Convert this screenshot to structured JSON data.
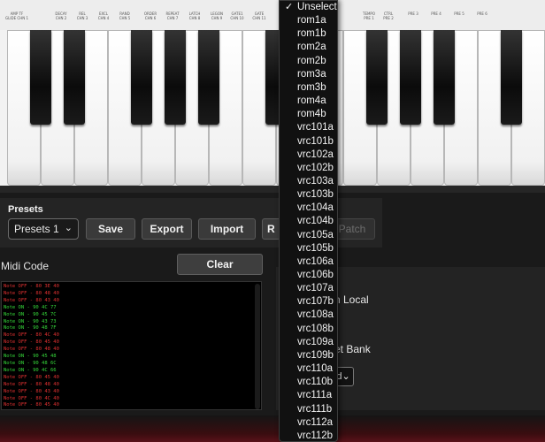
{
  "keyboard": {
    "knob_labels": [
      {
        "a": "AMP TF",
        "b": "GLIDE CHN 1"
      },
      {
        "a": "DECAY",
        "b": "CHN 2"
      },
      {
        "a": "REL",
        "b": "CHN 3"
      },
      {
        "a": "EXCL",
        "b": "CHN 4"
      },
      {
        "a": "RAND",
        "b": "CHN 5"
      },
      {
        "a": "ORDER",
        "b": "CHN 6"
      },
      {
        "a": "REPEAT",
        "b": "CHN 7"
      },
      {
        "a": "LATCH",
        "b": "CHN 8"
      },
      {
        "a": "LEGON",
        "b": "CHN 9"
      },
      {
        "a": "GATE1",
        "b": "CHN 10"
      },
      {
        "a": "GATE",
        "b": "CHN 11"
      },
      {
        "a": "TEMPO",
        "b": "PRE 1"
      },
      {
        "a": "CTRL",
        "b": "PRE 2"
      },
      {
        "a": "",
        "b": "PRE 3"
      },
      {
        "a": "",
        "b": "PRE 4"
      },
      {
        "a": "",
        "b": "PRE 5"
      },
      {
        "a": "",
        "b": "PRE 6"
      }
    ]
  },
  "presets": {
    "title": "Presets",
    "selected": "Presets 1",
    "buttons": [
      "Save",
      "Export",
      "Import",
      "R"
    ],
    "patch_label": "Patch"
  },
  "midi": {
    "title": "Midi Code",
    "clear_label": "Clear",
    "lines": [
      {
        "type": "off",
        "text": "Note OFF - 80 3E 40"
      },
      {
        "type": "off",
        "text": "Note OFF - 80 48 40"
      },
      {
        "type": "off",
        "text": "Note OFF - 80 43 40"
      },
      {
        "type": "on",
        "text": "Note ON - 90 4C 77"
      },
      {
        "type": "on",
        "text": "Note ON - 90 45 7C"
      },
      {
        "type": "on",
        "text": "Note ON - 90 43 73"
      },
      {
        "type": "on",
        "text": "Note ON - 90 48 7F"
      },
      {
        "type": "off",
        "text": "Note OFF - 80 4C 40"
      },
      {
        "type": "off",
        "text": "Note OFF - 80 45 40"
      },
      {
        "type": "off",
        "text": "Note OFF - 80 48 40"
      },
      {
        "type": "on",
        "text": "Note ON - 90 45 48"
      },
      {
        "type": "on",
        "text": "Note ON - 90 48 6C"
      },
      {
        "type": "on",
        "text": "Note ON - 90 4C 66"
      },
      {
        "type": "off",
        "text": "Note OFF - 80 45 40"
      },
      {
        "type": "off",
        "text": "Note OFF - 80 48 40"
      },
      {
        "type": "off",
        "text": "Note OFF - 80 43 40"
      },
      {
        "type": "off",
        "text": "Note OFF - 80 4C 40"
      },
      {
        "type": "off",
        "text": "Note OFF - 80 45 40"
      }
    ]
  },
  "right_panel": {
    "local_label": "n Local",
    "bank_label": "et Bank",
    "select_value": "d"
  },
  "dropdown": {
    "items": [
      "Unselect",
      "rom1a",
      "rom1b",
      "rom2a",
      "rom2b",
      "rom3a",
      "rom3b",
      "rom4a",
      "rom4b",
      "vrc101a",
      "vrc101b",
      "vrc102a",
      "vrc102b",
      "vrc103a",
      "vrc103b",
      "vrc104a",
      "vrc104b",
      "vrc105a",
      "vrc105b",
      "vrc106a",
      "vrc106b",
      "vrc107a",
      "vrc107b",
      "vrc108a",
      "vrc108b",
      "vrc109a",
      "vrc109b",
      "vrc110a",
      "vrc110b",
      "vrc111a",
      "vrc111b",
      "vrc112a",
      "vrc112b"
    ],
    "checked": "Unselect"
  }
}
